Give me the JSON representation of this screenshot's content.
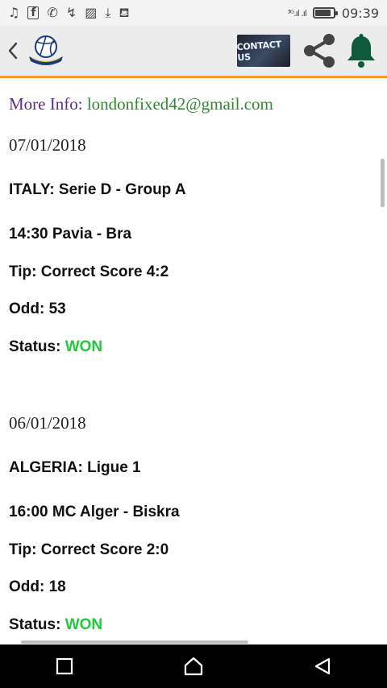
{
  "status_bar": {
    "notification_icons": [
      "music-note-icon",
      "facebook-icon",
      "whatsapp-icon",
      "missed-call-icon",
      "gallery-icon",
      "download-icon",
      "bag-icon"
    ],
    "network_text": "³ᴳ.ıl .ıl",
    "battery_level_percent": 85,
    "time": "09:39"
  },
  "toolbar": {
    "back_icon": "chevron-left-icon",
    "logo_icon": "volleyball-shield-icon",
    "contact_label": "CONTACT US",
    "share_icon": "share-icon",
    "bell_icon": "bell-icon",
    "accent_color": "#f29a2e"
  },
  "more_info": {
    "label": "More Info: ",
    "email": "londonfixed42@gmail.com"
  },
  "entries": [
    {
      "date": "07/01/2018",
      "league": "ITALY: Serie D - Group A",
      "match": "14:30 Pavia - Bra",
      "tip": "Tip: Correct Score 4:2",
      "odd": "Odd: 53",
      "status_label": "Status: ",
      "status_value": "WON"
    },
    {
      "date": "06/01/2018",
      "league": "ALGERIA: Ligue 1",
      "match": "16:00 MC Alger - Biskra",
      "tip": "Tip: Correct Score 2:0",
      "odd": "Odd: 18",
      "status_label": "Status: ",
      "status_value": "WON"
    }
  ],
  "colors": {
    "won": "#22c83e",
    "info_label": "#5b2d83",
    "email": "#2f8a2f"
  },
  "nav_bar": {
    "buttons": [
      "recents-square-icon",
      "home-icon",
      "back-triangle-icon"
    ]
  }
}
